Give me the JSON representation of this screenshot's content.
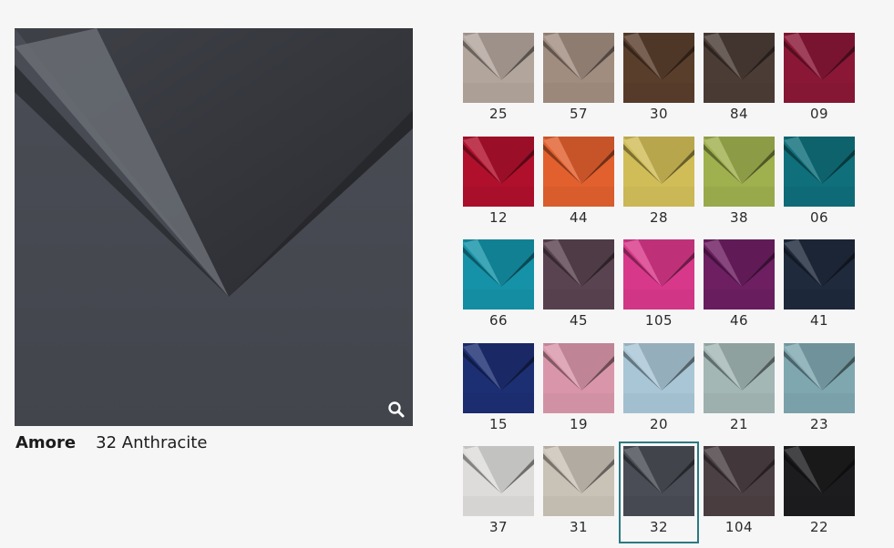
{
  "preview": {
    "base_color": "#4a4d55",
    "dark_color": "#2a2c31",
    "light_color": "#6a6d74",
    "zoom_icon": "magnifier-icon"
  },
  "caption": {
    "collection": "Amore",
    "variant": "32 Anthracite"
  },
  "swatches": [
    {
      "code": "25",
      "color": "#b2a59c"
    },
    {
      "code": "57",
      "color": "#a18d80"
    },
    {
      "code": "30",
      "color": "#5a3e2c"
    },
    {
      "code": "84",
      "color": "#4b3c35"
    },
    {
      "code": "09",
      "color": "#8a1736"
    },
    {
      "code": "12",
      "color": "#b0102c"
    },
    {
      "code": "44",
      "color": "#e2602e"
    },
    {
      "code": "28",
      "color": "#d1bd58"
    },
    {
      "code": "38",
      "color": "#9fb04e"
    },
    {
      "code": "06",
      "color": "#0f6f7a"
    },
    {
      "code": "66",
      "color": "#1592a7"
    },
    {
      "code": "45",
      "color": "#5a4350"
    },
    {
      "code": "105",
      "color": "#d8388a"
    },
    {
      "code": "46",
      "color": "#6d1f62"
    },
    {
      "code": "41",
      "color": "#1f2a3c"
    },
    {
      "code": "15",
      "color": "#1d2f73"
    },
    {
      "code": "19",
      "color": "#d996aa"
    },
    {
      "code": "20",
      "color": "#a9c6d6"
    },
    {
      "code": "21",
      "color": "#a3b7b5"
    },
    {
      "code": "23",
      "color": "#7fa7b0"
    },
    {
      "code": "37",
      "color": "#dddcda"
    },
    {
      "code": "31",
      "color": "#c9c2b7"
    },
    {
      "code": "32",
      "color": "#4a4d55"
    },
    {
      "code": "104",
      "color": "#4b4043"
    },
    {
      "code": "22",
      "color": "#1c1c1e"
    }
  ],
  "selected_code": "32",
  "accent_color": "#2b7a83"
}
